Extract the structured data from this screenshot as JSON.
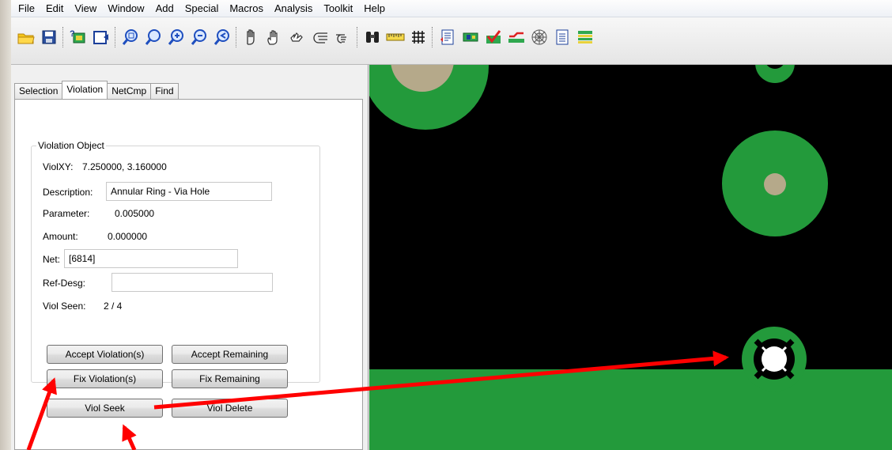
{
  "menu": {
    "items": [
      "File",
      "Edit",
      "View",
      "Window",
      "Add",
      "Special",
      "Macros",
      "Analysis",
      "Toolkit",
      "Help"
    ]
  },
  "toolbar": {
    "icons": [
      "open-folder-icon",
      "save-icon",
      "layers-icon",
      "export-icon",
      "zoom-window-icon",
      "zoom-all-icon",
      "zoom-in-icon",
      "zoom-out-icon",
      "zoom-previous-icon",
      "pan-hand-icon",
      "grab-hand-icon",
      "pick-hand-icon",
      "drag-hand-icon",
      "point-hand-icon",
      "binoculars-icon",
      "ruler-icon",
      "grid-icon",
      "report-icon",
      "board-icon",
      "drc-check-icon",
      "route-icon",
      "net-web-icon",
      "notes-icon",
      "layer-stack-icon"
    ]
  },
  "panel": {
    "tabs": [
      "Selection",
      "Violation",
      "NetCmp",
      "Find"
    ],
    "active_tab": "Violation",
    "group_title": "Violation Object",
    "violxy_label": "ViolXY:",
    "violxy_value": "7.250000, 3.160000",
    "description_label": "Description:",
    "description_value": "Annular Ring - Via Hole",
    "parameter_label": "Parameter:",
    "parameter_value": "0.005000",
    "amount_label": "Amount:",
    "amount_value": "0.000000",
    "net_label": "Net:",
    "net_value": "[6814]",
    "refdesg_label": "Ref-Desg:",
    "refdesg_value": "",
    "viol_seen_label": "Viol Seen:",
    "viol_seen_value": "2 / 4"
  },
  "buttons": {
    "accept_violations": "Accept Violation(s)",
    "accept_remaining": "Accept Remaining",
    "fix_violations": "Fix Violation(s)",
    "fix_remaining": "Fix Remaining",
    "viol_seek": "Viol Seek",
    "viol_delete": "Viol Delete"
  },
  "colors": {
    "pad_green": "#239a3b",
    "drill_tan": "#b5a98a",
    "canvas_bg": "#000000",
    "annotation_red": "#ff0000"
  }
}
